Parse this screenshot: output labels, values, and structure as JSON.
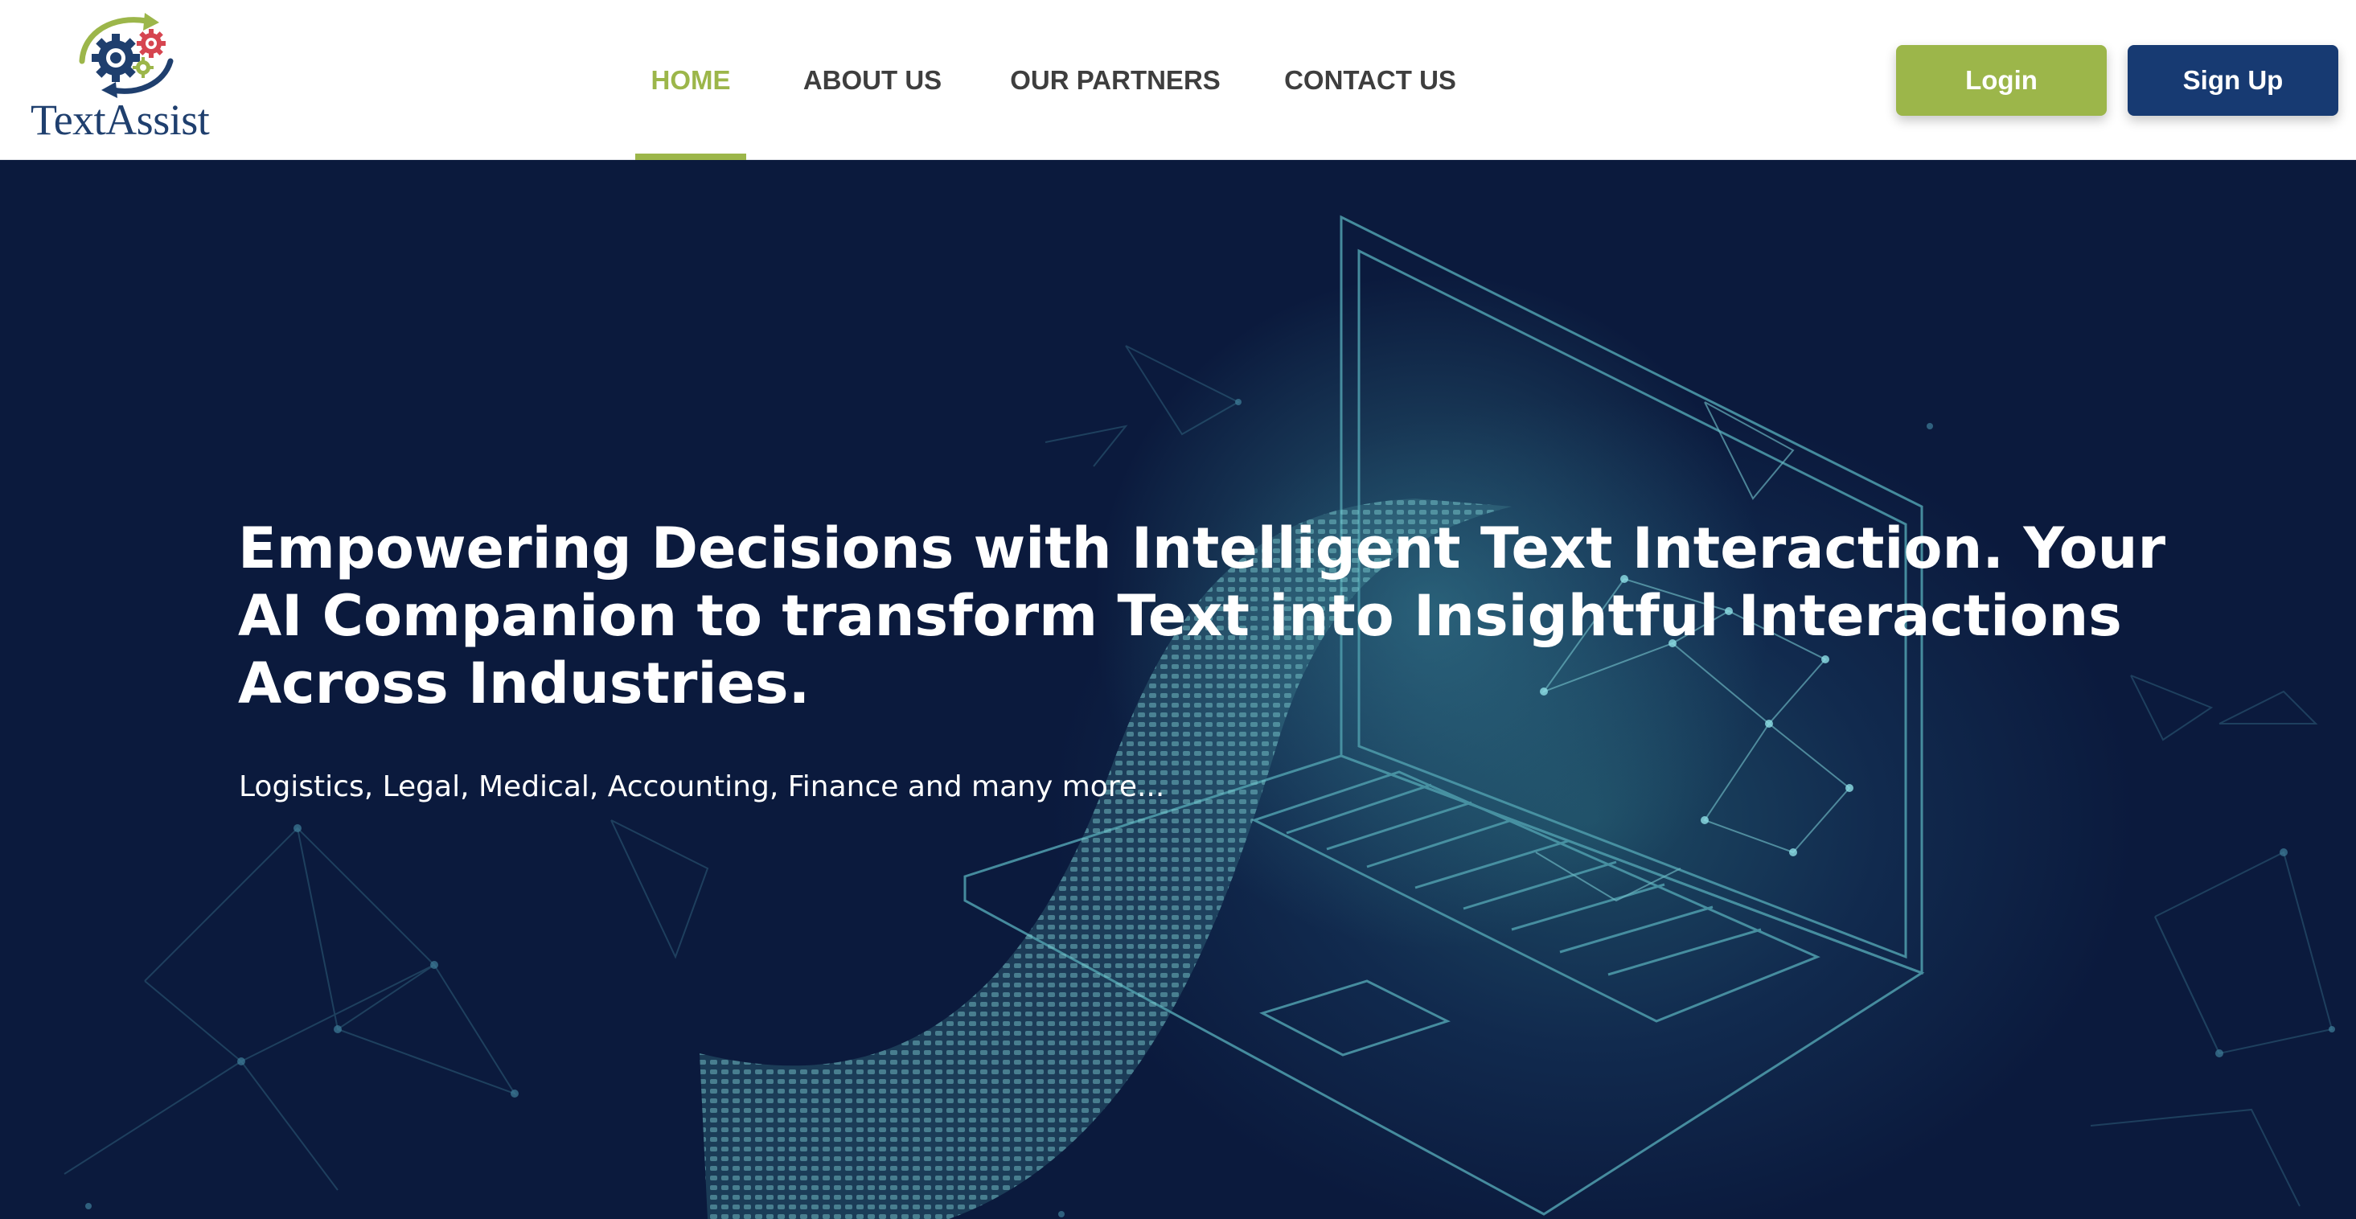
{
  "brand": {
    "name": "TextAssist",
    "colors": {
      "green": "#9cb64a",
      "navy": "#173a72",
      "red": "#d64550",
      "hero_bg": "#0b1a3d"
    }
  },
  "nav": {
    "items": [
      {
        "label": "HOME",
        "active": true
      },
      {
        "label": "ABOUT US",
        "active": false
      },
      {
        "label": "OUR PARTNERS",
        "active": false
      },
      {
        "label": "CONTACT US",
        "active": false
      }
    ]
  },
  "auth": {
    "login_label": "Login",
    "signup_label": "Sign Up"
  },
  "hero": {
    "title": "Empowering Decisions with Intelligent Text Interaction. Your AI Companion to transform Text into Insightful Interactions Across Industries.",
    "subtitle": "Logistics, Legal, Medical, Accounting, Finance and many more...",
    "illustration": "laptop-data-stream"
  },
  "icons": {
    "logo": "gears-arrows-logo-icon"
  }
}
